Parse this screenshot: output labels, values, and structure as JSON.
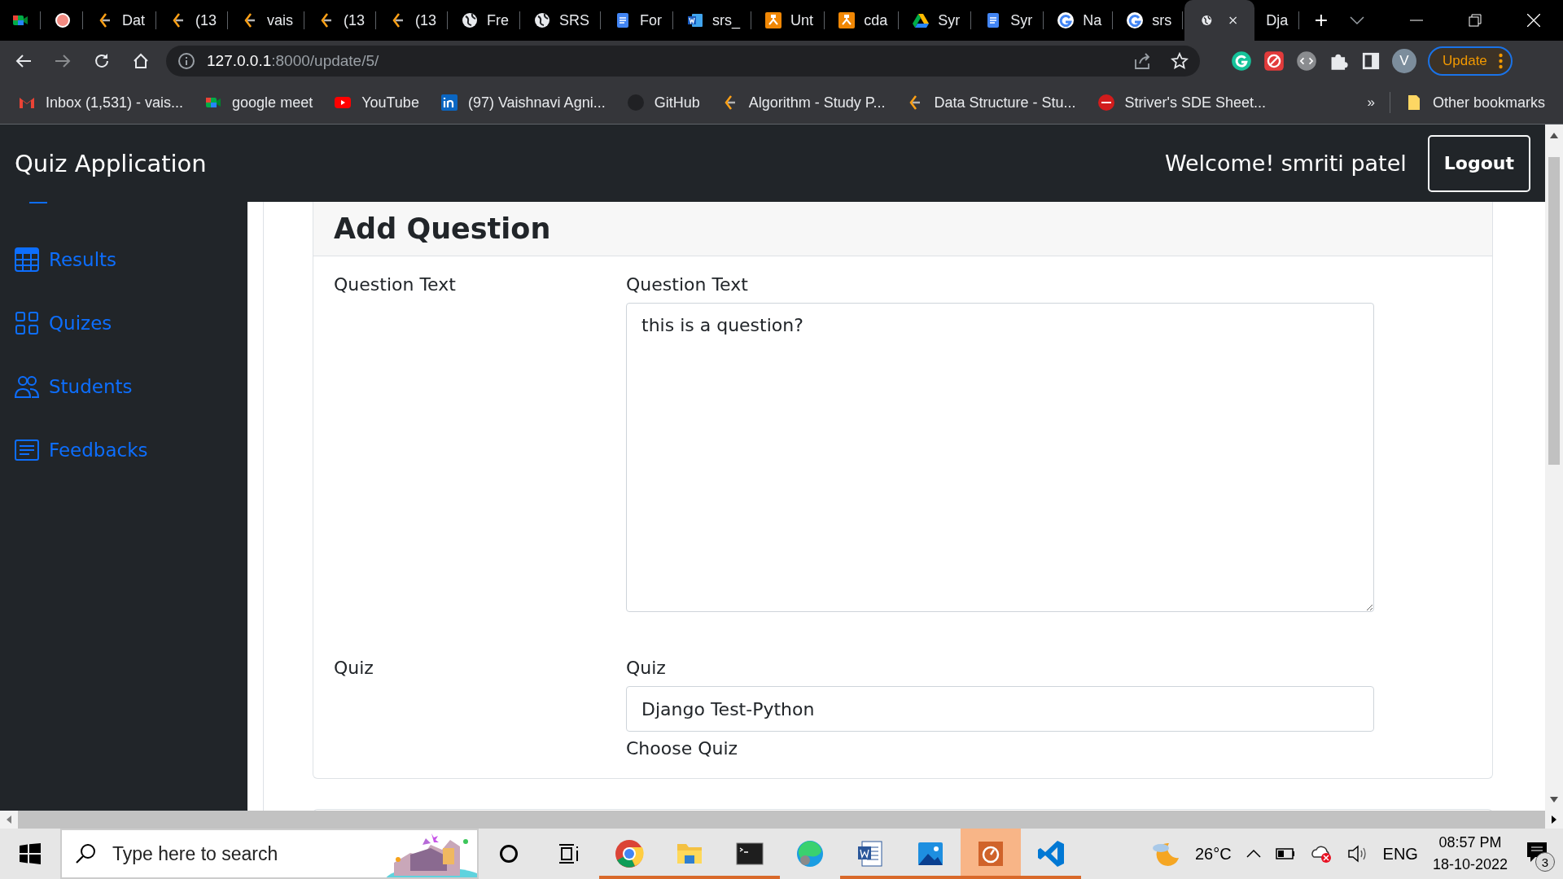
{
  "browser": {
    "tabs": [
      {
        "selected": false
      },
      {
        "selected": false
      },
      {
        "title": "Dat",
        "selected": false
      },
      {
        "title": "(13",
        "selected": false
      },
      {
        "title": "vais",
        "selected": false
      },
      {
        "title": "(13",
        "selected": false
      },
      {
        "title": "(13",
        "selected": false
      },
      {
        "title": "Fre",
        "selected": false
      },
      {
        "title": "SRS",
        "selected": false
      },
      {
        "title": "For",
        "selected": false
      },
      {
        "title": "srs_",
        "selected": false
      },
      {
        "title": "Unt",
        "selected": false
      },
      {
        "title": "cda",
        "selected": false
      },
      {
        "title": "Syr",
        "selected": false
      },
      {
        "title": "Syr",
        "selected": false
      },
      {
        "title": "Na",
        "selected": false
      },
      {
        "title": "srs",
        "selected": false
      },
      {
        "selected": true
      },
      {
        "title": "Dja",
        "selected": false
      }
    ],
    "address": {
      "host": "127.0.0.1",
      "path": ":8000/update/5/"
    },
    "profile_initial": "V",
    "update_button": "Update",
    "bookmarks": [
      {
        "title": "Inbox (1,531) - vais..."
      },
      {
        "title": "google meet"
      },
      {
        "title": "YouTube"
      },
      {
        "title": "(97) Vaishnavi Agni..."
      },
      {
        "title": "GitHub"
      },
      {
        "title": "Algorithm - Study P..."
      },
      {
        "title": "Data Structure - Stu..."
      },
      {
        "title": "Striver's SDE Sheet..."
      }
    ],
    "overflow": "»",
    "other_bookmarks": "Other bookmarks"
  },
  "app": {
    "brand": "Quiz Application",
    "welcome": "Welcome! smriti patel",
    "logout": "Logout",
    "sidebar": {
      "items": [
        {
          "label": "Results"
        },
        {
          "label": "Quizes"
        },
        {
          "label": "Students"
        },
        {
          "label": "Feedbacks"
        }
      ]
    },
    "form": {
      "title": "Add Question",
      "fields": [
        {
          "kind": "textarea",
          "label": "Question Text",
          "field_label": "Question Text",
          "value": "this is a question?"
        },
        {
          "kind": "select",
          "label": "Quiz",
          "field_label": "Quiz",
          "value": "Django Test-Python",
          "help": "Choose Quiz"
        }
      ]
    }
  },
  "taskbar": {
    "search_placeholder": "Type here to search",
    "apps": [
      {
        "running": true,
        "selected": false
      },
      {
        "running": true,
        "selected": false
      },
      {
        "running": true,
        "selected": false
      },
      {
        "running": false,
        "selected": false
      },
      {
        "running": true,
        "selected": false
      },
      {
        "running": true,
        "selected": false
      },
      {
        "running": true,
        "selected": true
      },
      {
        "running": true,
        "selected": false
      }
    ],
    "weather": "26°C",
    "language": "ENG",
    "time": "08:57 PM",
    "date": "18-10-2022",
    "notifications": "3"
  }
}
